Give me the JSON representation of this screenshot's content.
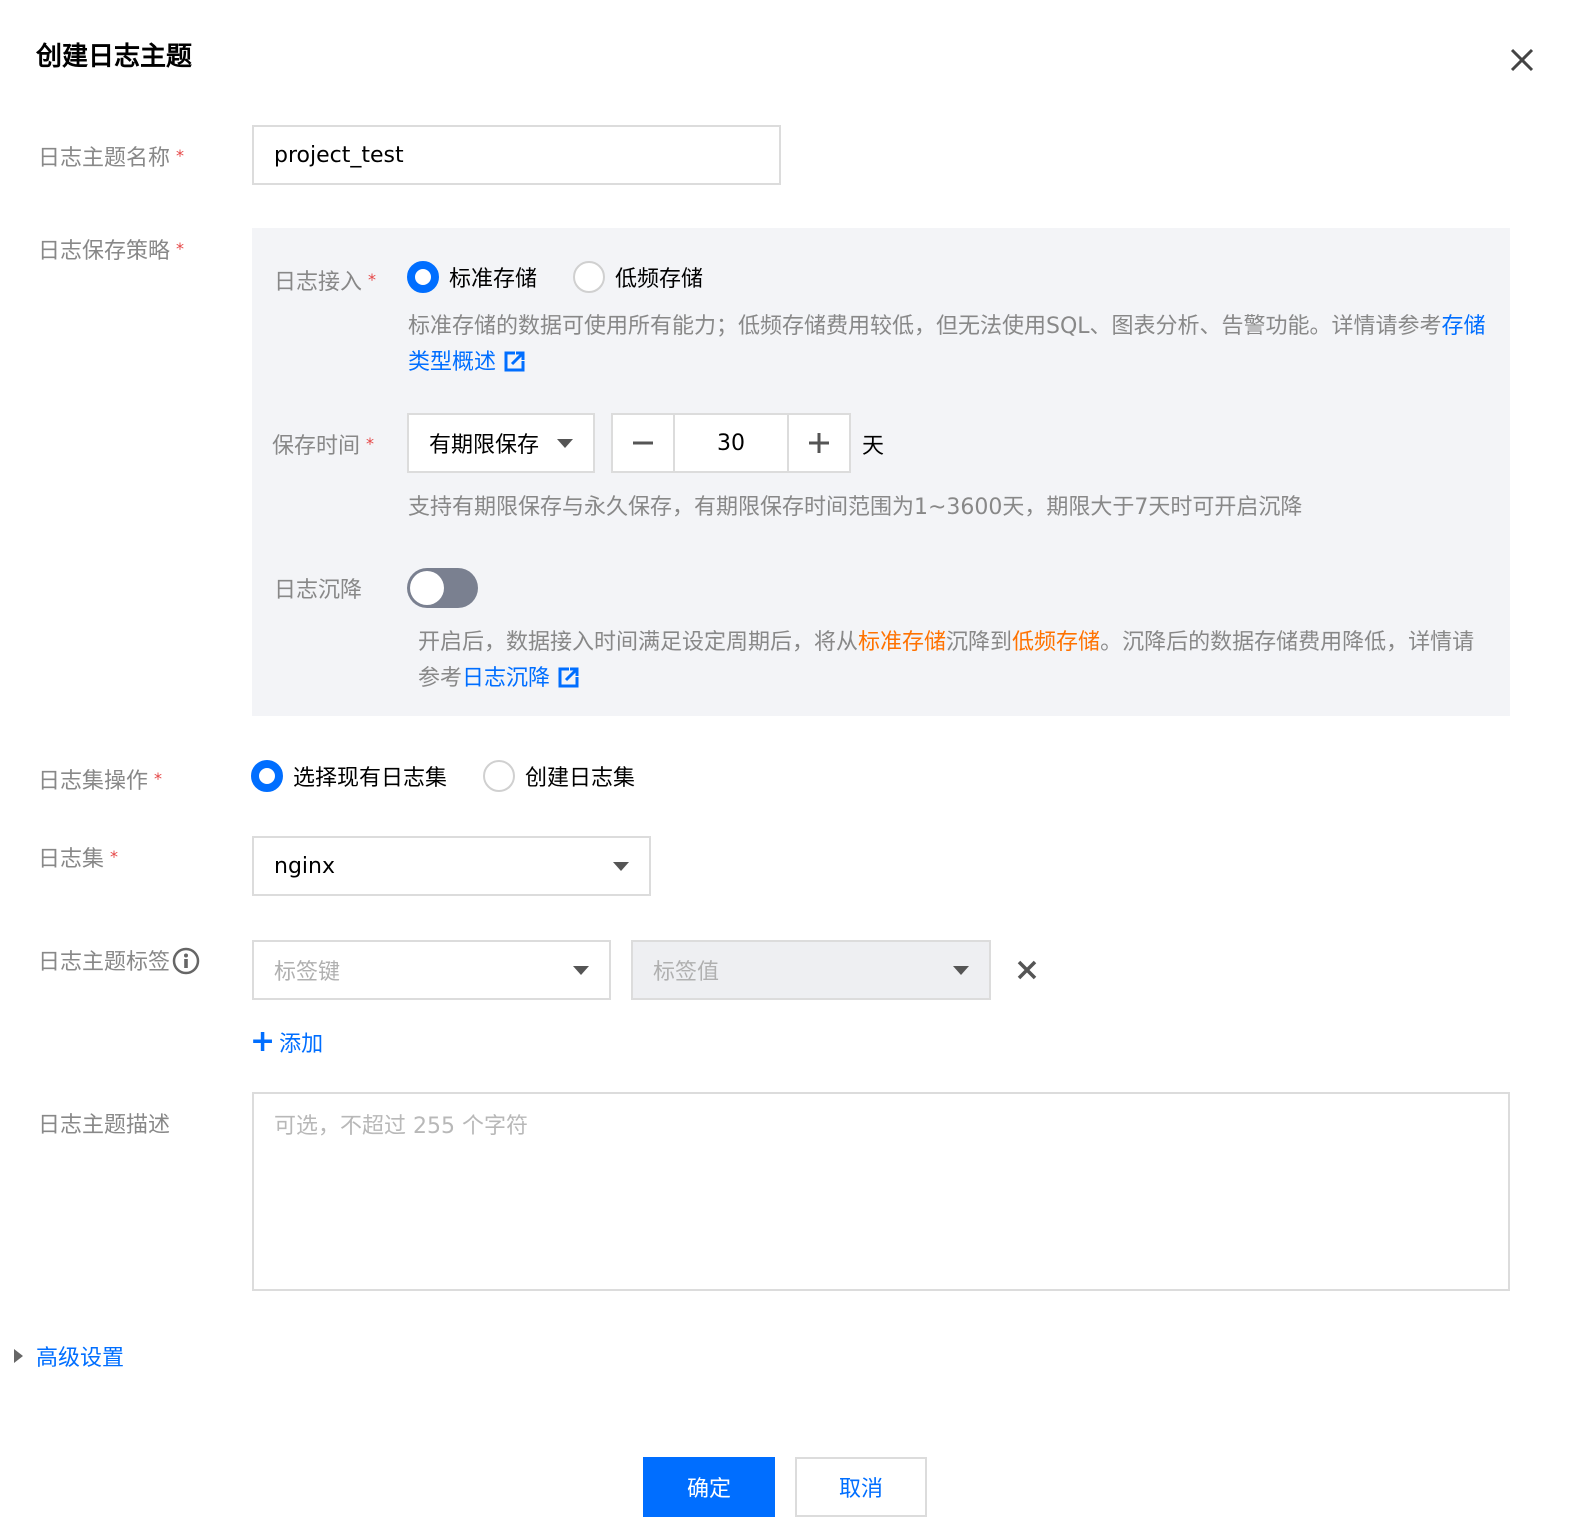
{
  "dialog": {
    "title": "创建日志主题",
    "close_icon": "close-icon"
  },
  "topic_name": {
    "label": "日志主题名称",
    "required_mark": "*",
    "value": "project_test"
  },
  "storage_policy": {
    "label": "日志保存策略",
    "required_mark": "*",
    "ingest": {
      "label": "日志接入",
      "required_mark": "*",
      "options": [
        "标准存储",
        "低频存储"
      ],
      "selected": "标准存储",
      "hint_prefix": "标准存储的数据可使用所有能力；低频存储费用较低，但无法使用SQL、图表分析、告警功能。详情请参考",
      "hint_link": "存储类型概述"
    },
    "retention": {
      "label": "保存时间",
      "required_mark": "*",
      "mode": "有期限保存",
      "days": "30",
      "unit": "天",
      "minus_icon": "minus-icon",
      "plus_icon": "plus-icon",
      "hint": "支持有期限保存与永久保存，有期限保存时间范围为1~3600天，期限大于7天时可开启沉降"
    },
    "sink": {
      "label": "日志沉降",
      "enabled": false,
      "hint_1": "开启后，数据接入时间满足设定周期后，将从",
      "hint_hot": "标准存储",
      "hint_2": "沉降到",
      "hint_cold": "低频存储",
      "hint_3": "。沉降后的数据存储费用降低，详情请参考",
      "hint_link": "日志沉降"
    }
  },
  "logset_op": {
    "label": "日志集操作",
    "required_mark": "*",
    "options": [
      "选择现有日志集",
      "创建日志集"
    ],
    "selected": "选择现有日志集"
  },
  "logset": {
    "label": "日志集",
    "required_mark": "*",
    "value": "nginx"
  },
  "tags": {
    "label": "日志主题标签",
    "key_placeholder": "标签键",
    "value_placeholder": "标签值",
    "add_label": "添加",
    "add_symbol": "+"
  },
  "description": {
    "label": "日志主题描述",
    "placeholder": "可选，不超过 255 个字符"
  },
  "advanced": {
    "label": "高级设置"
  },
  "footer": {
    "confirm": "确定",
    "cancel": "取消"
  },
  "colors": {
    "primary": "#006eff",
    "required": "#e54545",
    "highlight": "#ff7200",
    "panel_bg": "#f3f4f7"
  }
}
